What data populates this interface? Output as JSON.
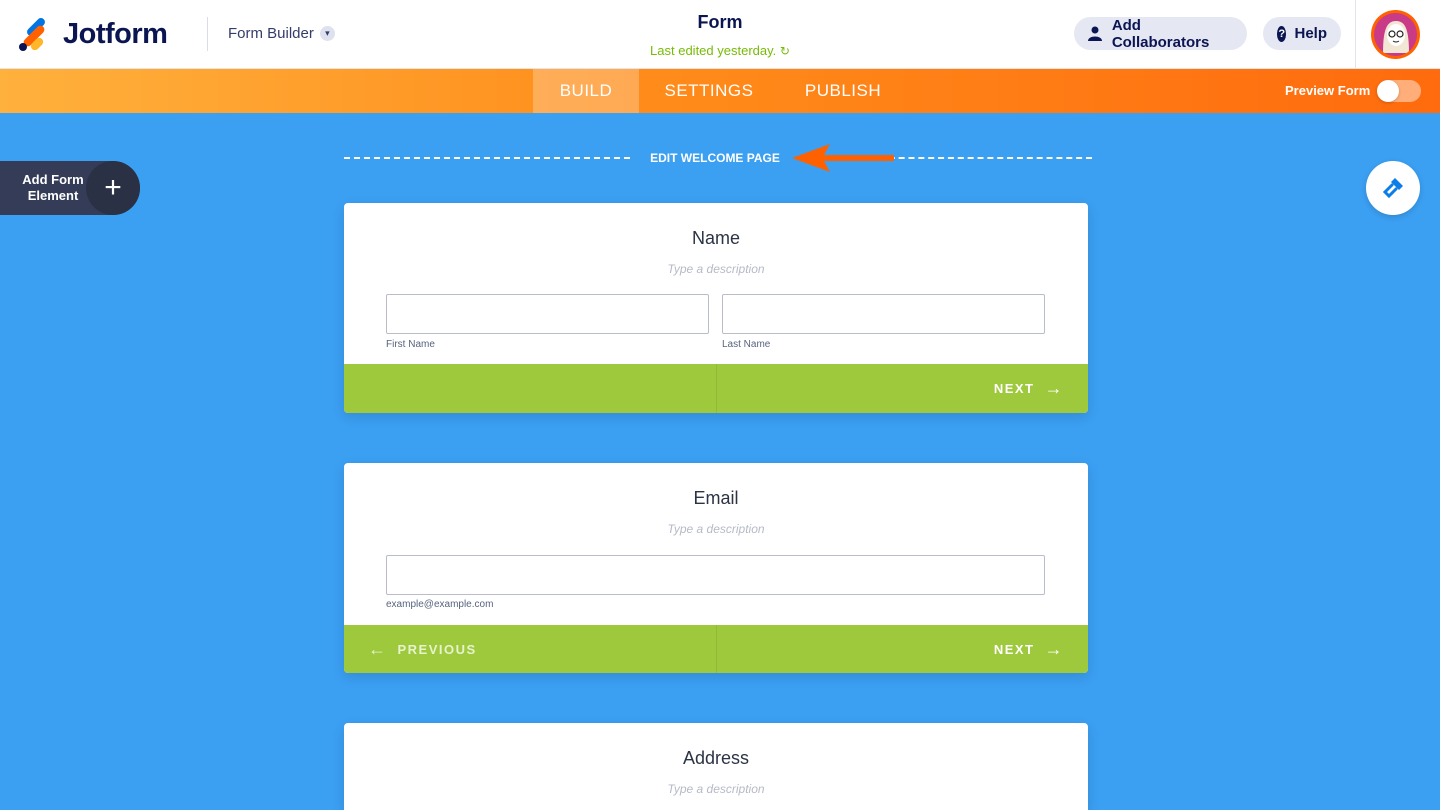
{
  "header": {
    "brand": "Jotform",
    "builder_label": "Form Builder",
    "form_title": "Form",
    "last_edited": "Last edited yesterday.",
    "collaborators_label": "Add Collaborators",
    "help_label": "Help"
  },
  "nav": {
    "tabs": [
      {
        "label": "BUILD",
        "active": true
      },
      {
        "label": "SETTINGS",
        "active": false
      },
      {
        "label": "PUBLISH",
        "active": false
      }
    ],
    "preview_label": "Preview Form",
    "preview_enabled": false
  },
  "sidebar": {
    "add_element_label": "Add Form Element"
  },
  "welcome": {
    "label": "EDIT WELCOME PAGE"
  },
  "cards": [
    {
      "title": "Name",
      "description_placeholder": "Type a description",
      "sublabels": [
        "First Name",
        "Last Name"
      ],
      "next_label": "NEXT"
    },
    {
      "title": "Email",
      "description_placeholder": "Type a description",
      "sublabel": "example@example.com",
      "prev_label": "PREVIOUS",
      "next_label": "NEXT"
    },
    {
      "title": "Address",
      "description_placeholder": "Type a description"
    }
  ],
  "colors": {
    "canvas": "#3b9ff2",
    "accent_orange": "#ff6100",
    "footer_green": "#9fc93c",
    "brand_navy": "#0a1551",
    "edited_green": "#78bb07"
  }
}
